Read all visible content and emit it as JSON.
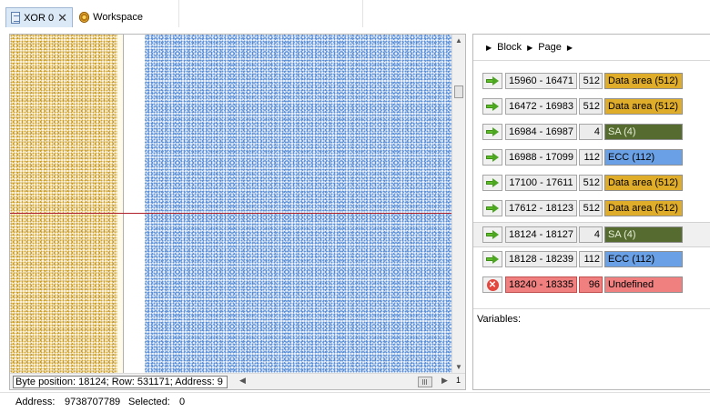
{
  "tabs": [
    {
      "label": "XOR 0",
      "icon": "document-icon",
      "active": true
    },
    {
      "label": "Workspace",
      "icon": "gear-icon",
      "active": false
    }
  ],
  "viewer": {
    "status_text": "Byte position: 18124; Row: 531171; Address: 9",
    "page_number": "1",
    "colors": {
      "left_pane": "#d0a52f",
      "right_pane": "#5b8fd6",
      "cursor_line": "#b0202a"
    }
  },
  "panel": {
    "breadcrumbs": [
      "Block",
      "Page"
    ],
    "rows": [
      {
        "range": "15960 - 16471",
        "size": "512",
        "type": "Data area (512)",
        "color": "#e0ad2b",
        "icon": "arrow-right-icon"
      },
      {
        "range": "16472 - 16983",
        "size": "512",
        "type": "Data area (512)",
        "color": "#e0ad2b",
        "icon": "arrow-right-icon"
      },
      {
        "range": "16984 - 16987",
        "size": "4",
        "type": "SA (4)",
        "color": "#556b2f",
        "icon": "arrow-right-icon"
      },
      {
        "range": "16988 - 17099",
        "size": "112",
        "type": "ECC (112)",
        "color": "#6aa1e6",
        "icon": "arrow-right-icon"
      },
      {
        "range": "17100 - 17611",
        "size": "512",
        "type": "Data area (512)",
        "color": "#e0ad2b",
        "icon": "arrow-right-icon"
      },
      {
        "range": "17612 - 18123",
        "size": "512",
        "type": "Data area (512)",
        "color": "#e0ad2b",
        "icon": "arrow-right-icon"
      },
      {
        "range": "18124 - 18127",
        "size": "4",
        "type": "SA (4)",
        "color": "#556b2f",
        "icon": "arrow-right-icon",
        "selected": true
      },
      {
        "range": "18128 - 18239",
        "size": "112",
        "type": "ECC (112)",
        "color": "#6aa1e6",
        "icon": "arrow-right-icon"
      },
      {
        "range": "18240 - 18335",
        "size": "96",
        "type": "Undefined",
        "color": "#f08080",
        "icon": "error-icon",
        "error": true
      }
    ],
    "variables_label": "Variables:"
  },
  "statusbar": {
    "address_label": "Address:",
    "address_value": "9738707789",
    "selected_label": "Selected:",
    "selected_value": "0"
  }
}
